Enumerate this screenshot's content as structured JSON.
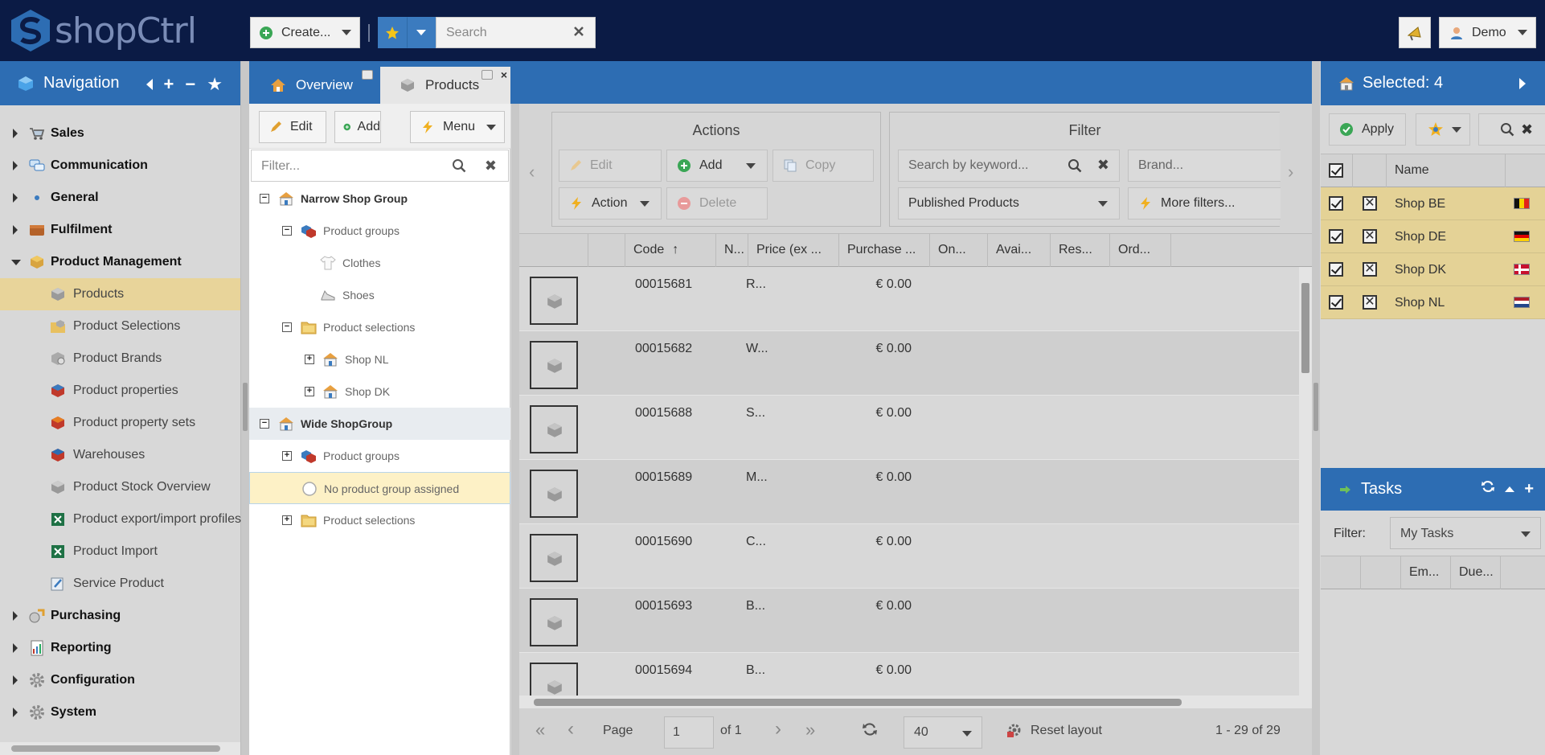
{
  "app": {
    "logo_text": "shopCtrl"
  },
  "topbar": {
    "create_label": "Create...",
    "search_placeholder": "Search",
    "user_label": "Demo"
  },
  "navigation": {
    "title": "Navigation",
    "items": [
      {
        "label": "Sales",
        "level": 0,
        "expanded": false,
        "icon": "cart-icon"
      },
      {
        "label": "Communication",
        "level": 0,
        "expanded": false,
        "icon": "chat-icon"
      },
      {
        "label": "General",
        "level": 0,
        "expanded": false,
        "icon": "dot-icon"
      },
      {
        "label": "Fulfilment",
        "level": 0,
        "expanded": false,
        "icon": "box-icon"
      },
      {
        "label": "Product Management",
        "level": 0,
        "expanded": true,
        "icon": "package-icon"
      },
      {
        "label": "Products",
        "level": 1,
        "selected": true,
        "icon": "cube-icon"
      },
      {
        "label": "Product Selections",
        "level": 1,
        "icon": "folder-cube-icon"
      },
      {
        "label": "Product Brands",
        "level": 1,
        "icon": "brand-icon"
      },
      {
        "label": "Product properties",
        "level": 1,
        "icon": "properties-icon"
      },
      {
        "label": "Product property sets",
        "level": 1,
        "icon": "property-sets-icon"
      },
      {
        "label": "Warehouses",
        "level": 1,
        "icon": "warehouse-icon"
      },
      {
        "label": "Product Stock Overview",
        "level": 1,
        "icon": "stock-icon"
      },
      {
        "label": "Product export/import profiles",
        "level": 1,
        "icon": "excel-icon"
      },
      {
        "label": "Product Import",
        "level": 1,
        "icon": "excel-icon"
      },
      {
        "label": "Service Product",
        "level": 1,
        "icon": "service-icon"
      },
      {
        "label": "Purchasing",
        "level": 0,
        "expanded": false,
        "icon": "purchasing-icon"
      },
      {
        "label": "Reporting",
        "level": 0,
        "expanded": false,
        "icon": "report-icon"
      },
      {
        "label": "Configuration",
        "level": 0,
        "expanded": false,
        "icon": "gear-icon"
      },
      {
        "label": "System",
        "level": 0,
        "expanded": false,
        "icon": "system-gear-icon"
      }
    ]
  },
  "tabs": [
    {
      "label": "Overview",
      "active": false
    },
    {
      "label": "Products",
      "active": true
    }
  ],
  "tree": {
    "edit_label": "Edit",
    "add_label": "Add",
    "menu_label": "Menu",
    "filter_placeholder": "Filter...",
    "nodes": [
      {
        "label": "Narrow Shop Group",
        "indent": 0,
        "box": "−",
        "root": true,
        "icon": "shop-icon"
      },
      {
        "label": "Product groups",
        "indent": 1,
        "box": "−",
        "icon": "groups-icon"
      },
      {
        "label": "Clothes",
        "indent": 2,
        "box": "",
        "icon": "shirt-icon"
      },
      {
        "label": "Shoes",
        "indent": 2,
        "box": "",
        "icon": "shoe-icon"
      },
      {
        "label": "Product selections",
        "indent": 1,
        "box": "−",
        "icon": "folder-icon"
      },
      {
        "label": "Shop NL",
        "indent": 2,
        "box": "+",
        "icon": "shop-icon"
      },
      {
        "label": "Shop DK",
        "indent": 2,
        "box": "+",
        "icon": "shop-icon"
      },
      {
        "label": "Wide ShopGroup",
        "indent": 0,
        "box": "−",
        "root": true,
        "icon": "shop-icon",
        "highlight": true
      },
      {
        "label": "Product groups",
        "indent": 1,
        "box": "+",
        "icon": "groups-icon"
      },
      {
        "label": "No product group assigned",
        "indent": 1,
        "box": "",
        "icon": "circle-icon",
        "selected": true
      },
      {
        "label": "Product selections",
        "indent": 1,
        "box": "+",
        "icon": "folder-icon"
      }
    ]
  },
  "grid": {
    "actions_title": "Actions",
    "filter_title": "Filter",
    "edit_label": "Edit",
    "add_label": "Add",
    "copy_label": "Copy",
    "action_label": "Action",
    "delete_label": "Delete",
    "search_placeholder": "Search by keyword...",
    "brand_placeholder": "Brand...",
    "published_label": "Published Products",
    "more_filters_label": "More filters...",
    "columns": [
      "",
      "",
      "Code",
      "N...",
      "Price (ex ...",
      "Purchase ...",
      "On...",
      "Avai...",
      "Res...",
      "Ord..."
    ],
    "rows": [
      {
        "code": "00015681",
        "name": "R...",
        "price": "€ 0.00"
      },
      {
        "code": "00015682",
        "name": "W...",
        "price": "€ 0.00"
      },
      {
        "code": "00015688",
        "name": "S...",
        "price": "€ 0.00"
      },
      {
        "code": "00015689",
        "name": "M...",
        "price": "€ 0.00"
      },
      {
        "code": "00015690",
        "name": "C...",
        "price": "€ 0.00"
      },
      {
        "code": "00015693",
        "name": "B...",
        "price": "€ 0.00"
      },
      {
        "code": "00015694",
        "name": "B...",
        "price": "€ 0.00"
      }
    ],
    "pager": {
      "page_label": "Page",
      "page_value": "1",
      "of_label": "of 1",
      "page_size": "40",
      "reset_label": "Reset layout",
      "range_label": "1 - 29 of 29"
    }
  },
  "selected_panel": {
    "title": "Selected: 4",
    "apply_label": "Apply",
    "name_header": "Name",
    "shops": [
      {
        "name": "Shop BE",
        "flag": [
          "#111111",
          "#f5d300",
          "#e2231a"
        ],
        "flag_dir": "vertical"
      },
      {
        "name": "Shop DE",
        "flag": [
          "#111111",
          "#dd0000",
          "#ffce00"
        ],
        "flag_dir": "horizontal"
      },
      {
        "name": "Shop DK",
        "flag": [
          "#c8102e",
          "#ffffff"
        ],
        "flag_dir": "cross"
      },
      {
        "name": "Shop NL",
        "flag": [
          "#ae1c28",
          "#ffffff",
          "#21468b"
        ],
        "flag_dir": "horizontal"
      }
    ]
  },
  "tasks": {
    "title": "Tasks",
    "filter_label": "Filter:",
    "filter_value": "My Tasks",
    "columns": [
      "",
      "",
      "Em...",
      "Due..."
    ]
  },
  "colors": {
    "topbar": "#0b1b45",
    "header_blue": "#2d6db3",
    "selected_row": "#e4d296"
  }
}
